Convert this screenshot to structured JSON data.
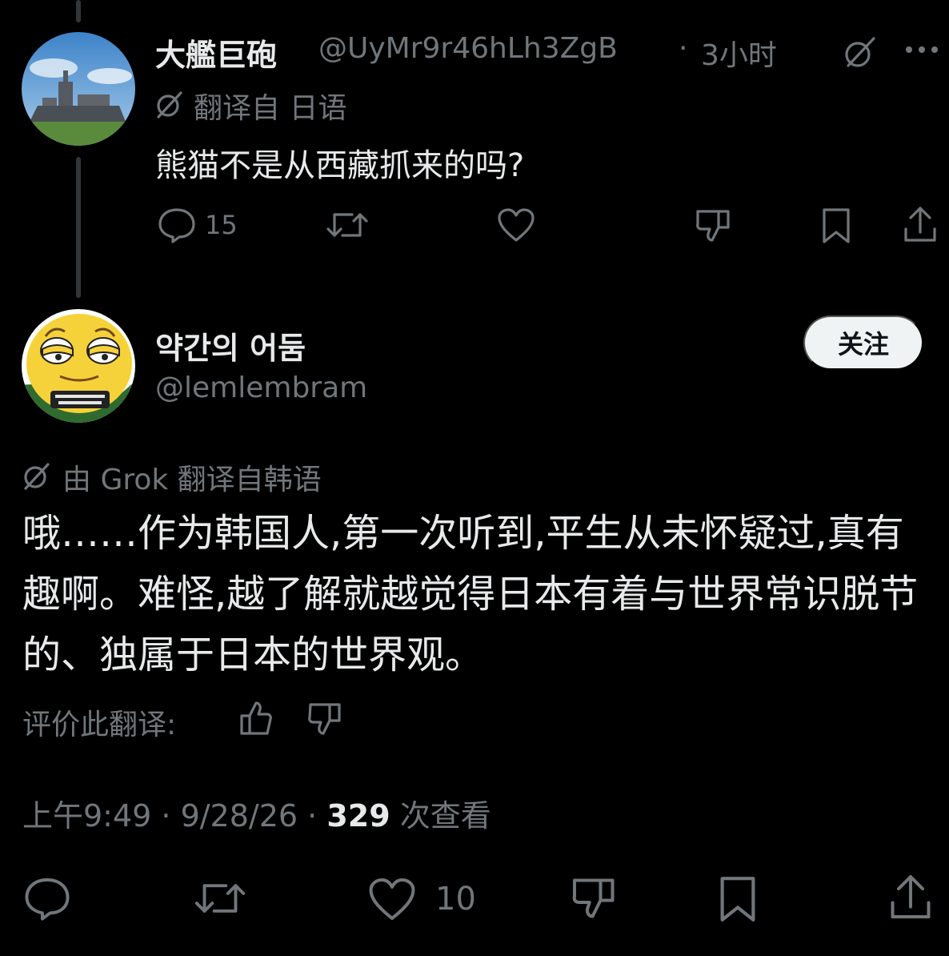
{
  "parent_tweet": {
    "display_name": "大艦巨砲",
    "handle": "@UyMr9r46hLh3ZgB",
    "separator": "·",
    "time": "3小时",
    "translation_note": "翻译自 日语",
    "text": "熊猫不是从西藏抓来的吗?",
    "reply_count": "15",
    "icons": [
      "grok-icon",
      "more-icon",
      "reply-icon",
      "retweet-icon",
      "like-icon",
      "dislike-icon",
      "bookmark-icon",
      "share-icon"
    ]
  },
  "main_tweet": {
    "display_name": "약간의 어둠",
    "handle": "@lemlembram",
    "follow_label": "关注",
    "translation_note": "由 Grok 翻译自韩语",
    "text": "哦……作为韩国人,第一次听到,平生从未怀疑过,真有趣啊。难怪,越了解就越觉得日本有着与世界常识脱节的、独属于日本的世界观。",
    "rate_translation_label": "评价此翻译:",
    "timestamp": "上午9:49 · 9/28/26 ·",
    "view_count": "329",
    "view_label": "次查看",
    "like_count": "10"
  },
  "colors": {
    "background": "#000000",
    "text_primary": "#e7e9ea",
    "text_secondary": "#71767b",
    "thread_line": "#333639",
    "follow_button_bg": "#eff3f4"
  }
}
